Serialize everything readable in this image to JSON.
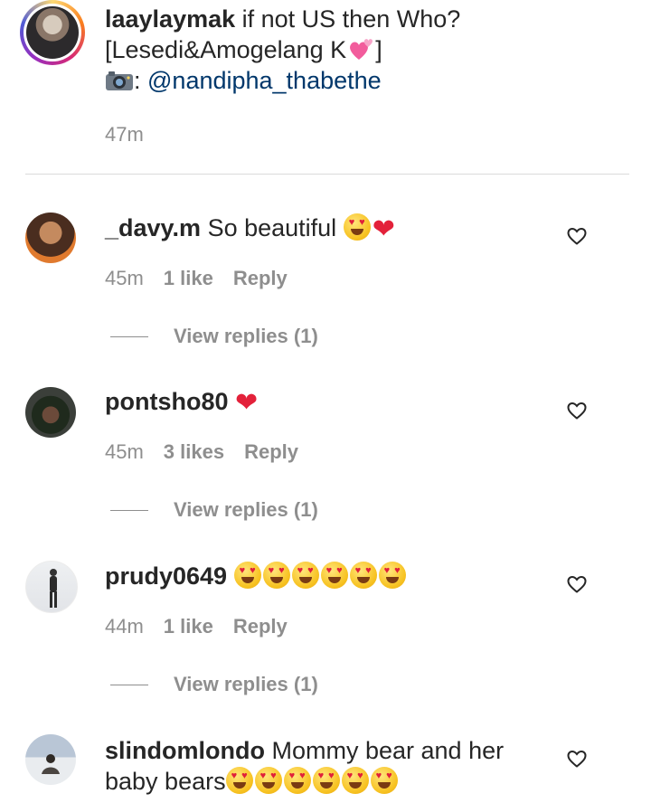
{
  "post": {
    "username": "laaylaymak",
    "caption_line1": " if not US then Who?",
    "caption_line2": "[Lesedi&Amogelang K",
    "caption_line2_end": "]",
    "caption_line3_prefix": ": ",
    "mention": "@nandipha_thabethe",
    "time": "47m"
  },
  "comments": [
    {
      "username": "_davy.m",
      "text": " So beautiful ",
      "time": "45m",
      "likes": "1 like",
      "reply_label": "Reply",
      "view_replies": "View replies (1)"
    },
    {
      "username": "pontsho80",
      "text": " ",
      "time": "45m",
      "likes": "3 likes",
      "reply_label": "Reply",
      "view_replies": "View replies (1)"
    },
    {
      "username": "prudy0649",
      "text": " ",
      "time": "44m",
      "likes": "1 like",
      "reply_label": "Reply",
      "view_replies": "View replies (1)"
    },
    {
      "username": "slindomlondo",
      "text": " Mommy bear and her baby bears"
    }
  ],
  "icons": {
    "like": "heart-outline-icon",
    "camera": "camera-icon",
    "emoji": "heart-eyes-emoji",
    "heart": "red-heart-emoji"
  },
  "colors": {
    "text": "#262626",
    "muted": "#8e8e8e",
    "mention": "#00376b",
    "divider": "#dbdbdb"
  }
}
